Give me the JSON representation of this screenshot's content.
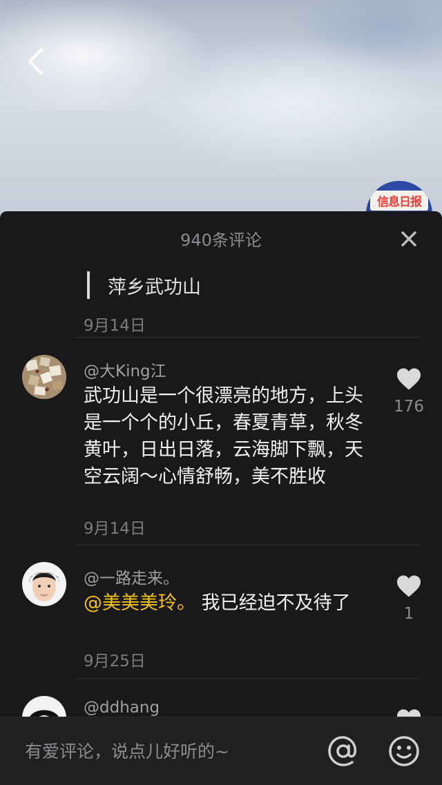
{
  "header": {
    "back_icon": "chevron-left-icon"
  },
  "watermark": {
    "text": "信息日报"
  },
  "panel": {
    "title": "940条评论",
    "close_icon": "close-icon"
  },
  "quote": {
    "text": "萍乡武功山",
    "date": "9月14日"
  },
  "comments": [
    {
      "username": "@大King江",
      "text": "武功山是一个很漂亮的地方，上头是一个个的小丘，春夏青草，秋冬黄叶，日出日落，云海脚下飘，天空云阔～心情舒畅，美不胜收",
      "date": "9月14日",
      "likes": "176"
    },
    {
      "username": "@一路走来。",
      "mention": "@美美美玲。",
      "text": " 我已经迫不及待了",
      "date": "9月25日",
      "likes": "1"
    },
    {
      "username": "@ddhang"
    }
  ],
  "composer": {
    "placeholder": "有爱评论，说点儿好听的~",
    "at_icon": "at-icon",
    "emoji_icon": "emoji-icon"
  },
  "colors": {
    "panel_bg": "#19191b",
    "mention": "#f5c218",
    "muted": "#7c7c80"
  }
}
